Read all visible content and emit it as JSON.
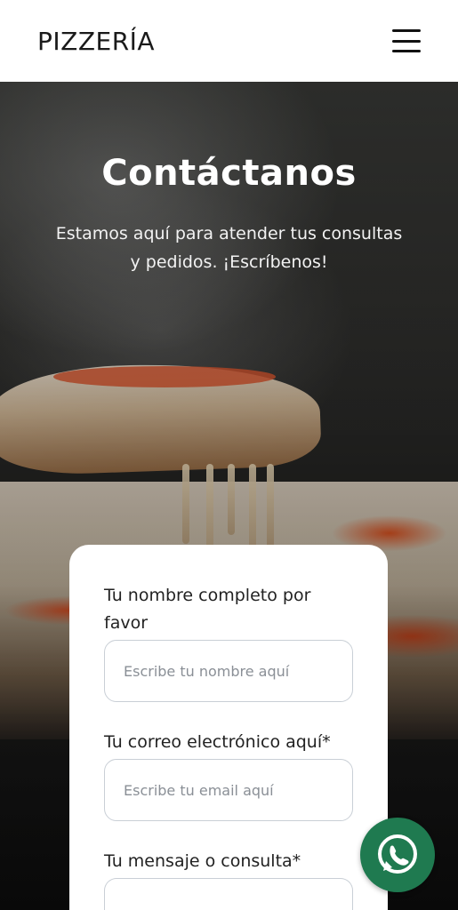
{
  "header": {
    "logo": "PIZZERÍA",
    "menu_icon": "hamburger-menu-icon"
  },
  "hero": {
    "title": "Contáctanos",
    "subtitle": "Estamos aquí para atender tus consultas y pedidos. ¡Escríbenos!"
  },
  "form": {
    "name_label": "Tu nombre completo por favor",
    "name_placeholder": "Escribe tu nombre aquí",
    "email_label": "Tu correo electrónico aquí*",
    "email_placeholder": "Escribe tu email aquí",
    "message_label": "Tu mensaje o consulta*"
  },
  "whatsapp": {
    "icon": "whatsapp-icon",
    "color": "#1f7a50"
  },
  "colors": {
    "header_bg": "#ffffff",
    "text_dark": "#222222",
    "input_border": "#c9cfd6"
  }
}
